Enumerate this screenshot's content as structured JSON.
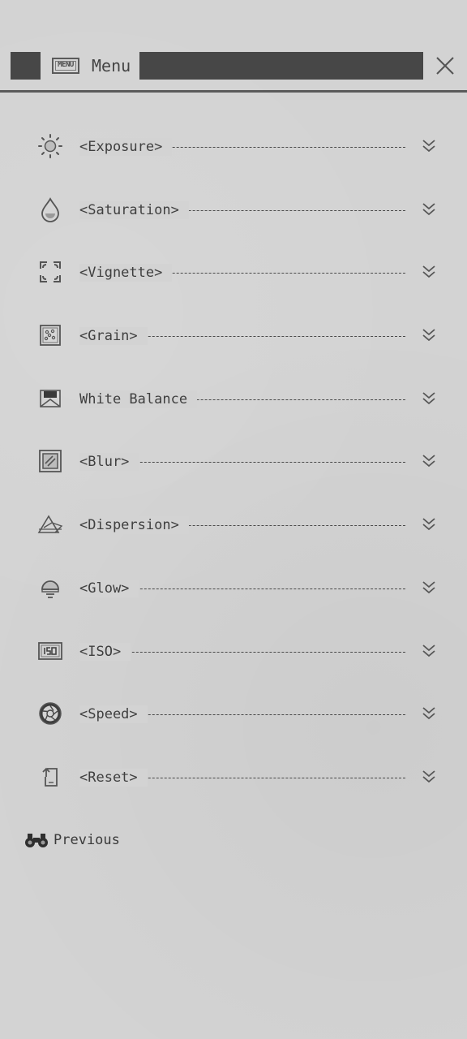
{
  "header": {
    "badge_text": "MENU",
    "title": "Menu",
    "close_icon": "close-icon"
  },
  "menu": {
    "items": [
      {
        "label": "<Exposure>",
        "icon": "sun-icon"
      },
      {
        "label": "<Saturation>",
        "icon": "droplet-icon"
      },
      {
        "label": "<Vignette>",
        "icon": "vignette-corners-icon"
      },
      {
        "label": "<Grain>",
        "icon": "grain-icon"
      },
      {
        "label": "White Balance",
        "icon": "white-balance-icon"
      },
      {
        "label": "<Blur>",
        "icon": "blur-icon"
      },
      {
        "label": "<Dispersion>",
        "icon": "dispersion-icon"
      },
      {
        "label": "<Glow>",
        "icon": "glow-icon"
      },
      {
        "label": "<ISO>",
        "icon": "iso-icon"
      },
      {
        "label": "<Speed>",
        "icon": "shutter-icon"
      },
      {
        "label": "<Reset>",
        "icon": "reset-icon"
      }
    ],
    "chevron_icon": "double-chevron-down-icon"
  },
  "footer": {
    "previous_label": "Previous",
    "previous_icon": "binoculars-icon"
  }
}
